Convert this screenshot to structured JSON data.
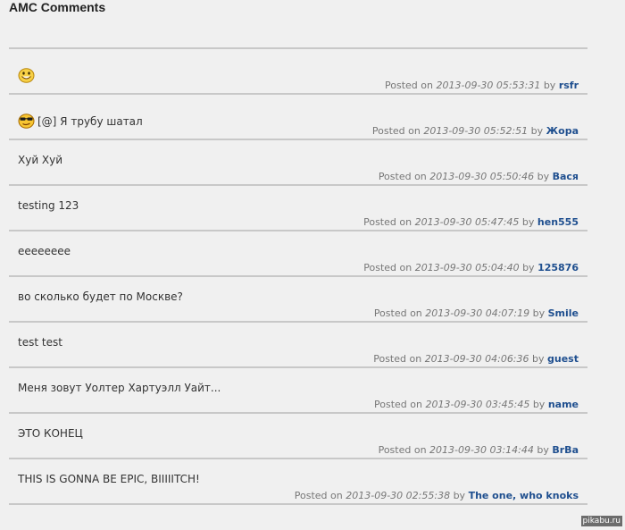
{
  "page": {
    "title": "AMC Comments"
  },
  "comments": [
    {
      "text": "",
      "icon": "grin-smiley-icon",
      "posted_on": "Posted on",
      "date": "2013-09-30 05:53:31",
      "by": "by",
      "author": "rsfr"
    },
    {
      "text": "[@] Я трубу шатал",
      "icon": "sunglasses-smiley-icon",
      "posted_on": "Posted on",
      "date": "2013-09-30 05:52:51",
      "by": "by",
      "author": "Жора"
    },
    {
      "text": "Хуй Хуй",
      "icon": "",
      "posted_on": "Posted on",
      "date": "2013-09-30 05:50:46",
      "by": "by",
      "author": "Вася"
    },
    {
      "text": "testing 123",
      "icon": "",
      "posted_on": "Posted on",
      "date": "2013-09-30 05:47:45",
      "by": "by",
      "author": "hen555"
    },
    {
      "text": "eeeeeeee",
      "icon": "",
      "posted_on": "Posted on",
      "date": "2013-09-30 05:04:40",
      "by": "by",
      "author": "125876"
    },
    {
      "text": "во сколько будет по Москве?",
      "icon": "",
      "posted_on": "Posted on",
      "date": "2013-09-30 04:07:19",
      "by": "by",
      "author": "Smile"
    },
    {
      "text": "test test",
      "icon": "",
      "posted_on": "Posted on",
      "date": "2013-09-30 04:06:36",
      "by": "by",
      "author": "guest"
    },
    {
      "text": "Меня зовут Уолтер Хартуэлл Уайт...",
      "icon": "",
      "posted_on": "Posted on",
      "date": "2013-09-30 03:45:45",
      "by": "by",
      "author": "name"
    },
    {
      "text": "ЭТО КОНЕЦ",
      "icon": "",
      "posted_on": "Posted on",
      "date": "2013-09-30 03:14:44",
      "by": "by",
      "author": "BrBa"
    },
    {
      "text": "THIS IS GONNA BE EPIC, BIIIIITCH!",
      "icon": "",
      "posted_on": "Posted on",
      "date": "2013-09-30 02:55:38",
      "by": "by",
      "author": "The one, who knoks"
    }
  ],
  "watermark": {
    "text": "pikabu.ru"
  },
  "colors": {
    "background": "#f0f0f0",
    "separator": "#c8c8c8",
    "author_link": "#1f4f8f",
    "meta_text": "#777777"
  }
}
